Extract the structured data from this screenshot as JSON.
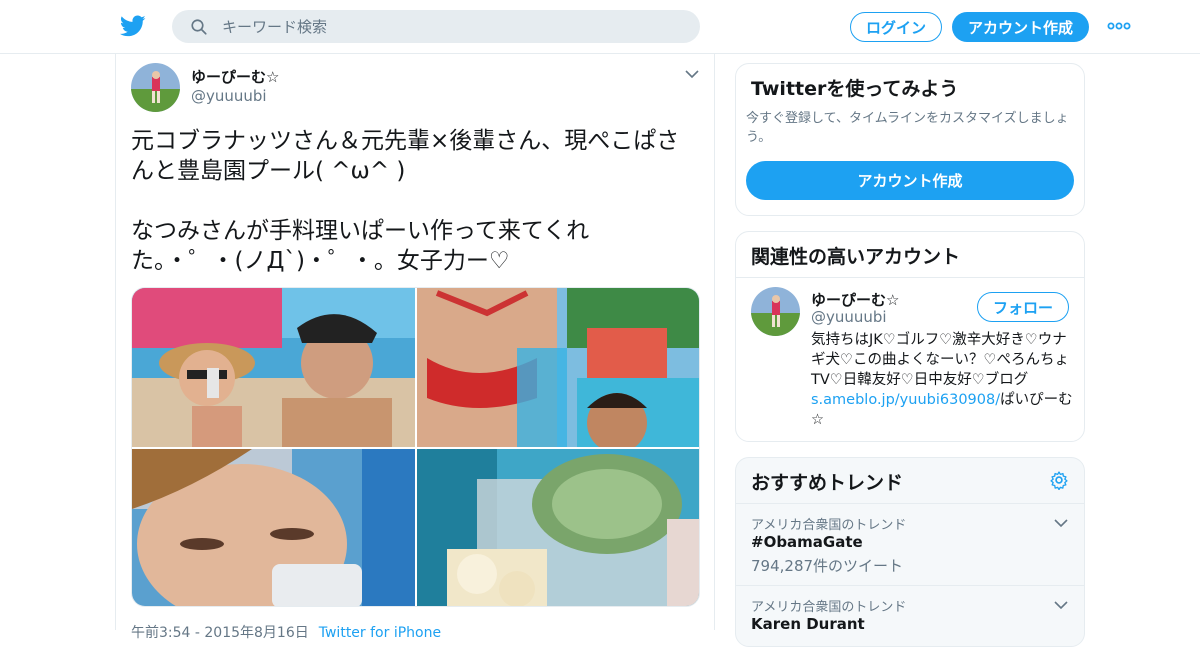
{
  "header": {
    "search_placeholder": "キーワード検索",
    "login_label": "ログイン",
    "signup_label": "アカウント作成"
  },
  "tweet": {
    "name": "ゆーぴーむ☆",
    "handle": "@yuuuubi",
    "text": "元コブラナッツさん＆元先輩×後輩さん、現ぺこぱさんと豊島園プール( ^ω^ )\n\nなつみさんが手料理いぱーい作って来てくれた。・゜・(ノД`)・゜・。女子力ー♡",
    "timestamp": "午前3:54 - 2015年8月16日",
    "source": "Twitter for iPhone"
  },
  "sidebar": {
    "try_title": "Twitterを使ってみよう",
    "try_desc": "今すぐ登録して、タイムラインをカスタマイズしましょう。",
    "try_button": "アカウント作成",
    "related_title": "関連性の高いアカウント",
    "related": {
      "name": "ゆーぴーむ☆",
      "handle": "@yuuuubi",
      "follow_label": "フォロー",
      "bio_before": "気持ちはJK♡ゴルフ♡激辛大好き♡ウナギ犬♡この曲よくなーい？♡ぺろんちょTV♡日韓友好♡日中友好♡ブログ",
      "bio_link": "s.ameblo.jp/yuubi630908/",
      "bio_after": "ぱいぴーむ☆"
    },
    "trends_title": "おすすめトレンド",
    "trends": [
      {
        "location": "アメリカ合衆国のトレンド",
        "name": "#ObamaGate",
        "count": "794,287件のツイート"
      },
      {
        "location": "アメリカ合衆国のトレンド",
        "name": "Karen Durant",
        "count": ""
      }
    ]
  },
  "colors": {
    "accent": "#1da1f2",
    "text": "#14171a",
    "muted": "#657786",
    "border": "#e6ecf0"
  }
}
